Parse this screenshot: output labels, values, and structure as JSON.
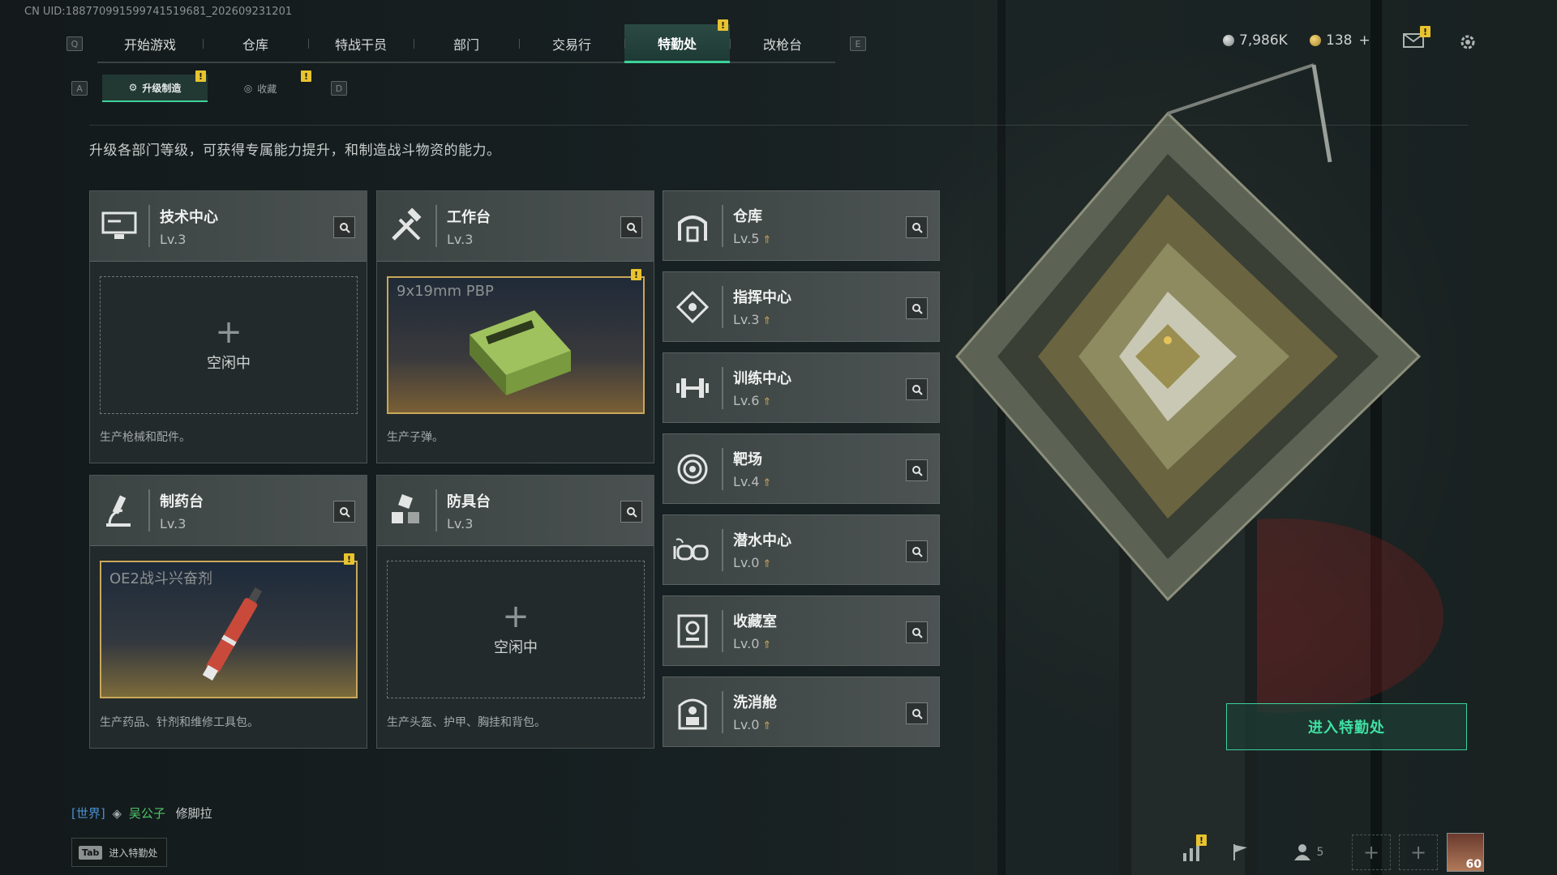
{
  "uid": "CN UID:1887709915997415196​81_202609231201",
  "nav": {
    "left_key": "Q",
    "right_key": "E",
    "tabs": [
      {
        "label": "开始游戏",
        "active": false
      },
      {
        "label": "仓库",
        "active": false
      },
      {
        "label": "特战干员",
        "active": false
      },
      {
        "label": "部门",
        "active": false
      },
      {
        "label": "交易行",
        "active": false
      },
      {
        "label": "特勤处",
        "active": true,
        "badge": "!"
      },
      {
        "label": "改枪台",
        "active": false
      }
    ]
  },
  "currency": {
    "silver": "7,986K",
    "gold": "138",
    "gold_add": "+"
  },
  "subtabs": {
    "left_key": "A",
    "right_key": "D",
    "items": [
      {
        "label": "升级制造",
        "active": true,
        "badge": "!"
      },
      {
        "label": "收藏",
        "active": false,
        "badge": "!"
      }
    ]
  },
  "intro": "升级各部门等级，可获得专属能力提升，和制造战斗物资的能力。",
  "workshops": [
    {
      "name": "技术中心",
      "level": "Lv.3",
      "icon": "computer-icon",
      "slot_state": "空闲中",
      "slot_plus": "+",
      "footer": "生产枪械和配件。"
    },
    {
      "name": "工作台",
      "level": "Lv.3",
      "icon": "tools-icon",
      "slot_item": "9x19mm PBP",
      "badge": "!",
      "footer": "生产子弹。"
    },
    {
      "name": "制药台",
      "level": "Lv.3",
      "icon": "microscope-icon",
      "slot_item": "OE2战斗兴奋剂",
      "badge": "!",
      "footer": "生产药品、针剂和维修工具包。"
    },
    {
      "name": "防具台",
      "level": "Lv.3",
      "icon": "cubes-icon",
      "slot_state": "空闲中",
      "slot_plus": "+",
      "footer": "生产头盔、护甲、胸挂和背包。"
    }
  ],
  "facilities": [
    {
      "name": "仓库",
      "level": "Lv.5",
      "icon": "warehouse-icon"
    },
    {
      "name": "指挥中心",
      "level": "Lv.3",
      "icon": "command-icon"
    },
    {
      "name": "训练中心",
      "level": "Lv.6",
      "icon": "dumbbell-icon"
    },
    {
      "name": "靶场",
      "level": "Lv.4",
      "icon": "target-icon"
    },
    {
      "name": "潜水中心",
      "level": "Lv.0",
      "icon": "goggles-icon"
    },
    {
      "name": "收藏室",
      "level": "Lv.0",
      "icon": "trophy-icon"
    },
    {
      "name": "洗消舱",
      "level": "Lv.0",
      "icon": "hazmat-icon"
    }
  ],
  "enter_button": "进入特勤处",
  "chat": {
    "channel": "[世界]",
    "user": "吴公子",
    "message": "修脚拉"
  },
  "tab_hint": {
    "key": "Tab",
    "label": "进入特勤处"
  },
  "bottom": {
    "friends_count": "5",
    "player_level": "60",
    "add": "+"
  },
  "colors": {
    "accent": "#3cd29a",
    "badge": "#e8c32e",
    "gold": "#c9a75a"
  }
}
